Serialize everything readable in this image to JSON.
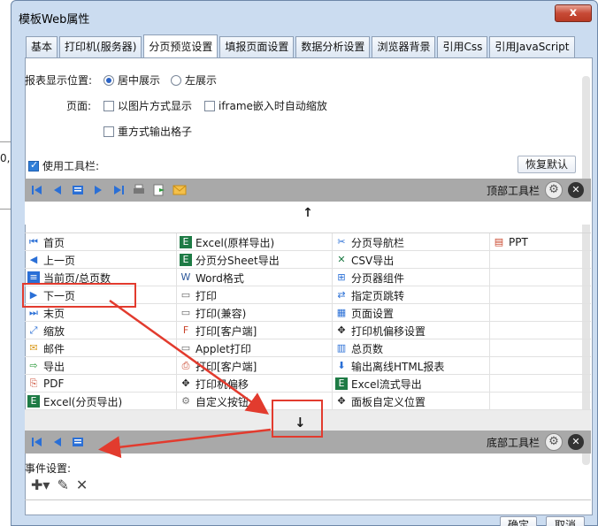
{
  "background": {
    "partial_text": "0,"
  },
  "window": {
    "title": "模板Web属性",
    "close_label": "x"
  },
  "tabs": [
    {
      "label": "基本"
    },
    {
      "label": "打印机(服务器)"
    },
    {
      "label": "分页预览设置",
      "active": true
    },
    {
      "label": "填报页面设置"
    },
    {
      "label": "数据分析设置"
    },
    {
      "label": "浏览器背景"
    },
    {
      "label": "引用Css"
    },
    {
      "label": "引用JavaScript"
    }
  ],
  "report_position": {
    "label": "报表显示位置:",
    "options": [
      "居中展示",
      "左展示"
    ],
    "selected": "居中展示"
  },
  "page": {
    "label": "页面:",
    "options": [
      "以图片方式显示",
      "iframe嵌入时自动缩放",
      "重方式输出格子"
    ]
  },
  "toolbar": {
    "use_label": "使用工具栏:",
    "use_checked": true,
    "reset_label": "恢复默认",
    "top_label": "顶部工具栏",
    "bottom_label": "底部工具栏",
    "up_arrow": "↑",
    "down_arrow": "↓"
  },
  "items": [
    [
      "首页",
      "Excel(原样导出)",
      "分页导航栏",
      "PPT"
    ],
    [
      "上一页",
      "分页分Sheet导出",
      "CSV导出",
      ""
    ],
    [
      "当前页/总页数",
      "Word格式",
      "分页器组件",
      ""
    ],
    [
      "下一页",
      "打印",
      "指定页跳转",
      ""
    ],
    [
      "末页",
      "打印(兼容)",
      "页面设置",
      ""
    ],
    [
      "缩放",
      "打印[客户端]",
      "打印机偏移设置",
      ""
    ],
    [
      "邮件",
      "Applet打印",
      "总页数",
      ""
    ],
    [
      "导出",
      "打印[客户端]",
      "输出离线HTML报表",
      ""
    ],
    [
      "PDF",
      "打印机偏移",
      "Excel流式导出",
      ""
    ],
    [
      "Excel(分页导出)",
      "自定义按钮",
      "面板自定义位置",
      ""
    ]
  ],
  "events": {
    "label": "事件设置:"
  },
  "buttons": {
    "ok": "确定",
    "cancel": "取消"
  },
  "colors": {
    "highlight": "#e23b2e",
    "toolbar_gray": "#a9a9a9",
    "dialog_bg": "#cbdcf0"
  }
}
